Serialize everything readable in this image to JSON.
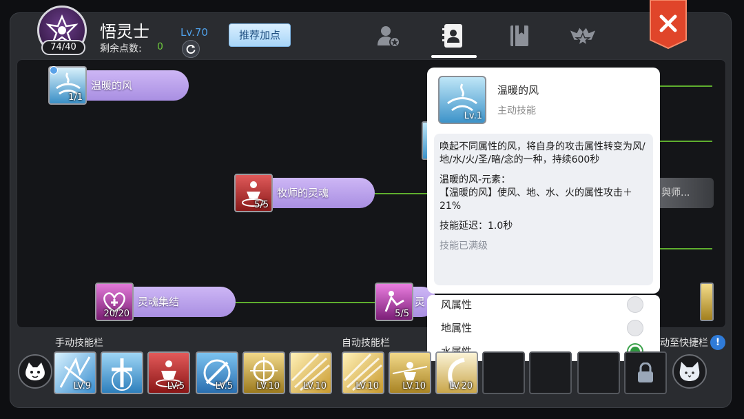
{
  "header": {
    "job_name": "悟灵士",
    "level": "Lv.70",
    "remaining_points_label": "剩余点数:",
    "remaining_points_value": "0",
    "avatar_count": "74/40",
    "recommend_button": "推荐加点"
  },
  "tabs": [
    {
      "icon": "profile-star-icon"
    },
    {
      "icon": "skill-book-icon",
      "active": true
    },
    {
      "icon": "bookmark-book-icon"
    },
    {
      "icon": "crown-star-emblem-icon"
    }
  ],
  "skill_tree": {
    "nodes": [
      {
        "name": "温暖的风",
        "count": "1/1",
        "icon": "warm-wind-icon"
      },
      {
        "name": "牧师的灵魂",
        "count": "5/5",
        "icon": "priest-soul-icon"
      },
      {
        "name": "灵魂集结",
        "count": "20/20",
        "icon": "soul-gather-icon"
      },
      {
        "name": "灵",
        "count": "5/5",
        "icon": "soul-spirit-icon"
      }
    ],
    "ghost_node_label": "與师..."
  },
  "tooltip": {
    "title": "温暖的风",
    "type": "主动技能",
    "level": "Lv.1",
    "description": "唤起不同属性的风，将自身的攻击属性转变为风/地/水/火/圣/暗/念的一种，持续600秒",
    "element_heading": "温暖的风-元素：",
    "element_effect": "【温暖的风】使风、地、水、火的属性攻击＋21%",
    "delay": "技能延迟：1.0秒",
    "status": "技能已满级"
  },
  "element_options": [
    {
      "label": "风属性",
      "selected": false
    },
    {
      "label": "地属性",
      "selected": false
    },
    {
      "label": "水属性",
      "selected": true
    }
  ],
  "bottom_bar": {
    "manual_label": "手动技能栏",
    "auto_label": "自动技能栏",
    "shortcut_label": "动至快捷栏",
    "manual_slots": [
      {
        "level": "LV.9",
        "color": "ice"
      },
      {
        "level": "",
        "color": "blue-cross"
      },
      {
        "level": "LV.5",
        "color": "red"
      },
      {
        "level": "LV.5",
        "color": "blue-sword"
      },
      {
        "level": "LV.10",
        "color": "gold"
      },
      {
        "level": "LV.10",
        "color": "gold-light"
      }
    ],
    "auto_slots": [
      {
        "level": "LV.10",
        "color": "gold-light"
      },
      {
        "level": "LV.10",
        "color": "gold-figure"
      },
      {
        "level": "LV.20",
        "color": "gold-white"
      }
    ]
  },
  "colors": {
    "accent_green": "#5fae2e",
    "level_blue": "#4fa0e8",
    "close_red": "#e0452a",
    "node_purple": "#b9a1ea"
  }
}
